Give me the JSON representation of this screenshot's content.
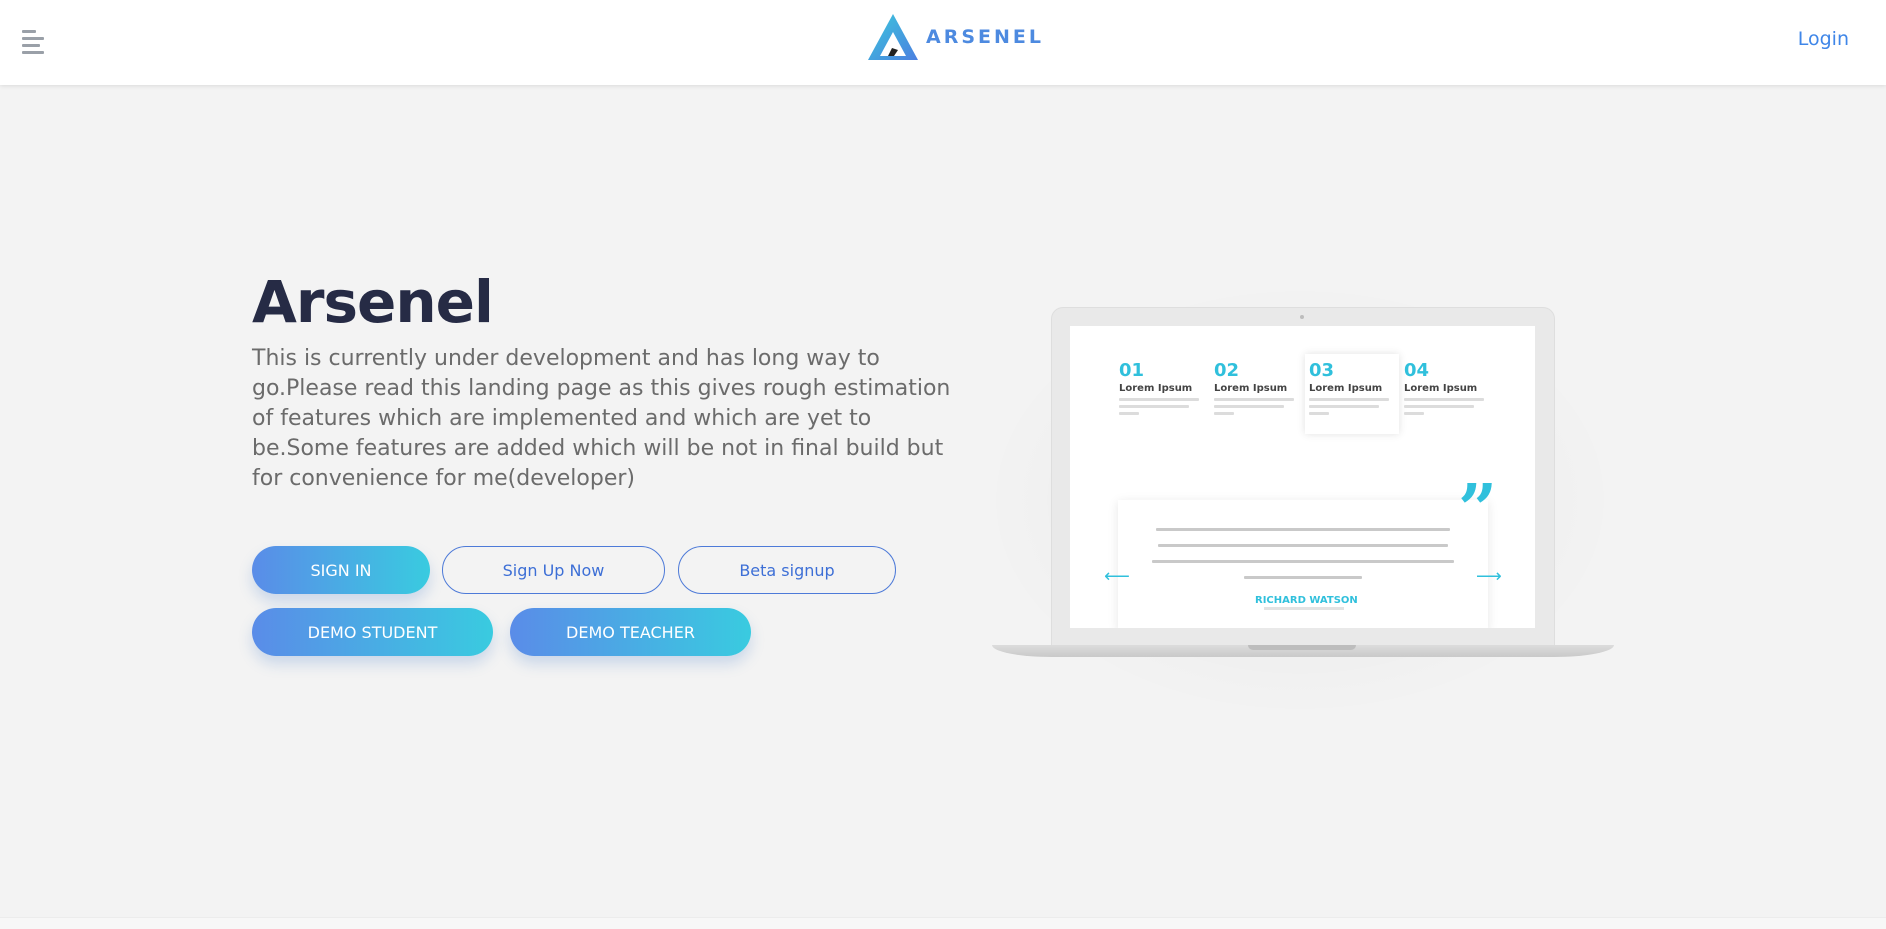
{
  "nav": {
    "brand_name": "ARSENEL",
    "login_label": "Login"
  },
  "hero": {
    "title": "Arsenel",
    "description": "This is currently under development and has long way to go.Please read this landing page as this gives rough estimation of features which are implemented and which are yet to be.Some features are added which will be not in final build but for convenience for me(developer)"
  },
  "buttons": {
    "sign_in": "SIGN IN",
    "sign_up": "Sign Up Now",
    "beta": "Beta signup",
    "demo_student": "DEMO STUDENT",
    "demo_teacher": "DEMO TEACHER"
  },
  "laptop_preview": {
    "steps": [
      {
        "num": "01",
        "title": "Lorem Ipsum"
      },
      {
        "num": "02",
        "title": "Lorem Ipsum"
      },
      {
        "num": "03",
        "title": "Lorem Ipsum"
      },
      {
        "num": "04",
        "title": "Lorem Ipsum"
      }
    ],
    "testimonial_name": "RICHARD WATSON"
  },
  "colors": {
    "accent": "#3f86e8",
    "gradient_start": "#5a8ce8",
    "gradient_end": "#39cbe0",
    "title": "#262b45"
  }
}
